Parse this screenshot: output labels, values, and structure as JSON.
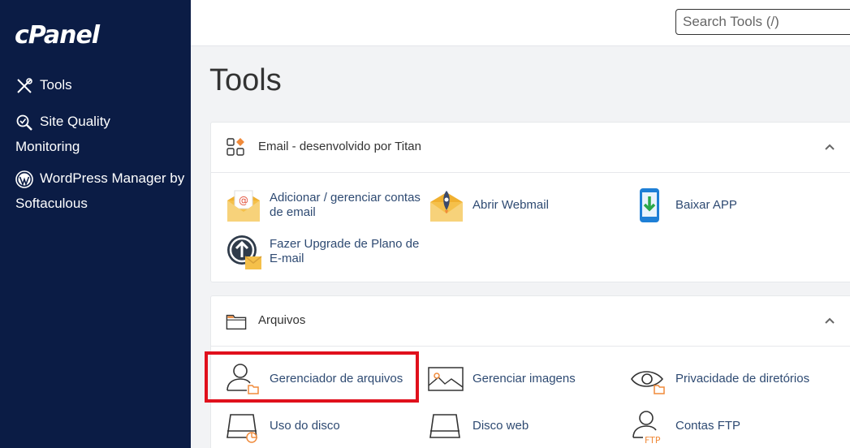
{
  "sidebar": {
    "logo": "cPanel",
    "items": [
      {
        "label": "Tools",
        "icon": "tools-icon"
      },
      {
        "label": "Site Quality Monitoring",
        "icon": "site-quality-icon"
      },
      {
        "label": "WordPress Manager by Softaculous",
        "icon": "wordpress-icon"
      }
    ]
  },
  "header": {
    "search_placeholder": "Search Tools (/)"
  },
  "main": {
    "title": "Tools",
    "groups": [
      {
        "title": "Email - desenvolvido por Titan",
        "icon": "apps-grid-icon",
        "items": [
          {
            "label": "Adicionar / gerenciar contas de email",
            "icon": "email-envelope-icon"
          },
          {
            "label": "Abrir Webmail",
            "icon": "rocket-envelope-icon"
          },
          {
            "label": "Baixar APP",
            "icon": "mobile-download-icon"
          },
          {
            "label": "Fazer Upgrade de Plano de E-mail",
            "icon": "upgrade-arrow-icon"
          }
        ]
      },
      {
        "title": "Arquivos",
        "icon": "folder-icon",
        "items": [
          {
            "label": "Gerenciador de arquivos",
            "icon": "file-manager-icon"
          },
          {
            "label": "Gerenciar imagens",
            "icon": "images-icon"
          },
          {
            "label": "Privacidade de diretórios",
            "icon": "eye-privacy-icon"
          },
          {
            "label": "Uso do disco",
            "icon": "disk-usage-icon"
          },
          {
            "label": "Disco web",
            "icon": "web-disk-icon"
          },
          {
            "label": "Contas FTP",
            "icon": "ftp-accounts-icon"
          }
        ]
      }
    ]
  },
  "colors": {
    "sidebar_bg": "#0b1c45",
    "link": "#2e4a72",
    "accent_orange": "#f08a3a",
    "highlight_red": "#e0101c"
  }
}
